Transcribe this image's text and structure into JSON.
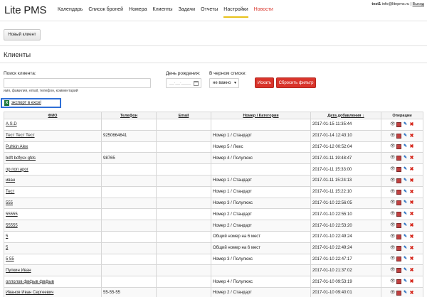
{
  "app": {
    "logo": "Lite PMS"
  },
  "nav": [
    "Календарь",
    "Список броней",
    "Номера",
    "Клиенты",
    "Задачи",
    "Отчеты",
    "Настройки",
    "Новости"
  ],
  "user": {
    "name": "test1",
    "email": "info@litepms.ru",
    "sep": "|",
    "logout": "Выход"
  },
  "toolbar": {
    "new_client": "Новый клиент"
  },
  "page": {
    "title": "Клиенты"
  },
  "filters": {
    "search_label": "Поиск клиента:",
    "search_value": "",
    "search_hint": "имя, фамилия, email, телефон, комментарий",
    "birthday_label": "День рождения:",
    "birthday_placeholder": "__.__.____",
    "blacklist_label": "В черном списке:",
    "blacklist_value": "не важно",
    "search_button": "Искать",
    "reset_button": "Сбросить фильтр"
  },
  "export": {
    "icon_text": "X",
    "label": "экспорт в excel"
  },
  "table": {
    "headers": [
      "ФИО",
      "Телефон",
      "Email",
      "Номер / Категория",
      "Дата добавления ↓",
      "Операции"
    ],
    "rows": [
      {
        "name": "A.S.D",
        "phone": "",
        "email": "",
        "room": "",
        "date": "2017-01-15 11:35:44"
      },
      {
        "name": "Тест Тест Тест",
        "phone": "9250664641",
        "email": "",
        "room": "Номер 1 / Стандарт",
        "date": "2017-01-14 12:43:10"
      },
      {
        "name": "Puhkin Alex",
        "phone": "",
        "email": "",
        "room": "Номер 5 / Люкс",
        "date": "2017-01-12 00:52:04"
      },
      {
        "name": "bdft bdfysx gfds",
        "phone": "98765",
        "email": "",
        "room": "Номер 4 / Полулюкс",
        "date": "2017-01-11 19:48:47"
      },
      {
        "name": "пр поп арог",
        "phone": "",
        "email": "",
        "room": "",
        "date": "2017-01-11 15:33:00"
      },
      {
        "name": "иван",
        "phone": "",
        "email": "",
        "room": "Номер 1 / Стандарт",
        "date": "2017-01-11 15:24:13"
      },
      {
        "name": "Тест",
        "phone": "",
        "email": "",
        "room": "Номер 1 / Стандарт",
        "date": "2017-01-11 15:22:10"
      },
      {
        "name": "555",
        "phone": "",
        "email": "",
        "room": "Номер 3 / Полулюкс",
        "date": "2017-01-10 22:56:05"
      },
      {
        "name": "55555",
        "phone": "",
        "email": "",
        "room": "Номер 2 / Стандарт",
        "date": "2017-01-10 22:55:10"
      },
      {
        "name": "55555",
        "phone": "",
        "email": "",
        "room": "Номер 2 / Стандарт",
        "date": "2017-01-10 22:53:20"
      },
      {
        "name": "5",
        "phone": "",
        "email": "",
        "room": "Общий номер на 6 мест",
        "date": "2017-01-10 22:49:24"
      },
      {
        "name": "5",
        "phone": "",
        "email": "",
        "room": "Общий номер на 6 мест",
        "date": "2017-01-10 22:49:24"
      },
      {
        "name": "5 55",
        "phone": "",
        "email": "",
        "room": "Номер 3 / Полулюкс",
        "date": "2017-01-10 22:47:17"
      },
      {
        "name": "Пупкин Иван",
        "phone": "",
        "email": "",
        "room": "",
        "date": "2017-01-10 21:37:02"
      },
      {
        "name": "оллолов фвфыв фвфыв",
        "phone": "",
        "email": "",
        "room": "Номер 4 / Полулюкс",
        "date": "2017-01-10 09:53:19"
      },
      {
        "name": "Иванов Иван Сергеевич",
        "phone": "55-55-55",
        "email": "",
        "room": "Номер 2 / Стандарт",
        "date": "2017-01-10 09:40:01"
      }
    ]
  },
  "icons": {
    "view": "eye-icon",
    "calendar": "calendar-icon",
    "edit": "pencil-icon",
    "delete": "delete-icon"
  },
  "colors": {
    "accent_red": "#d9342b",
    "export_border": "#2f6fd6",
    "active_underline": "#e8c21a"
  }
}
